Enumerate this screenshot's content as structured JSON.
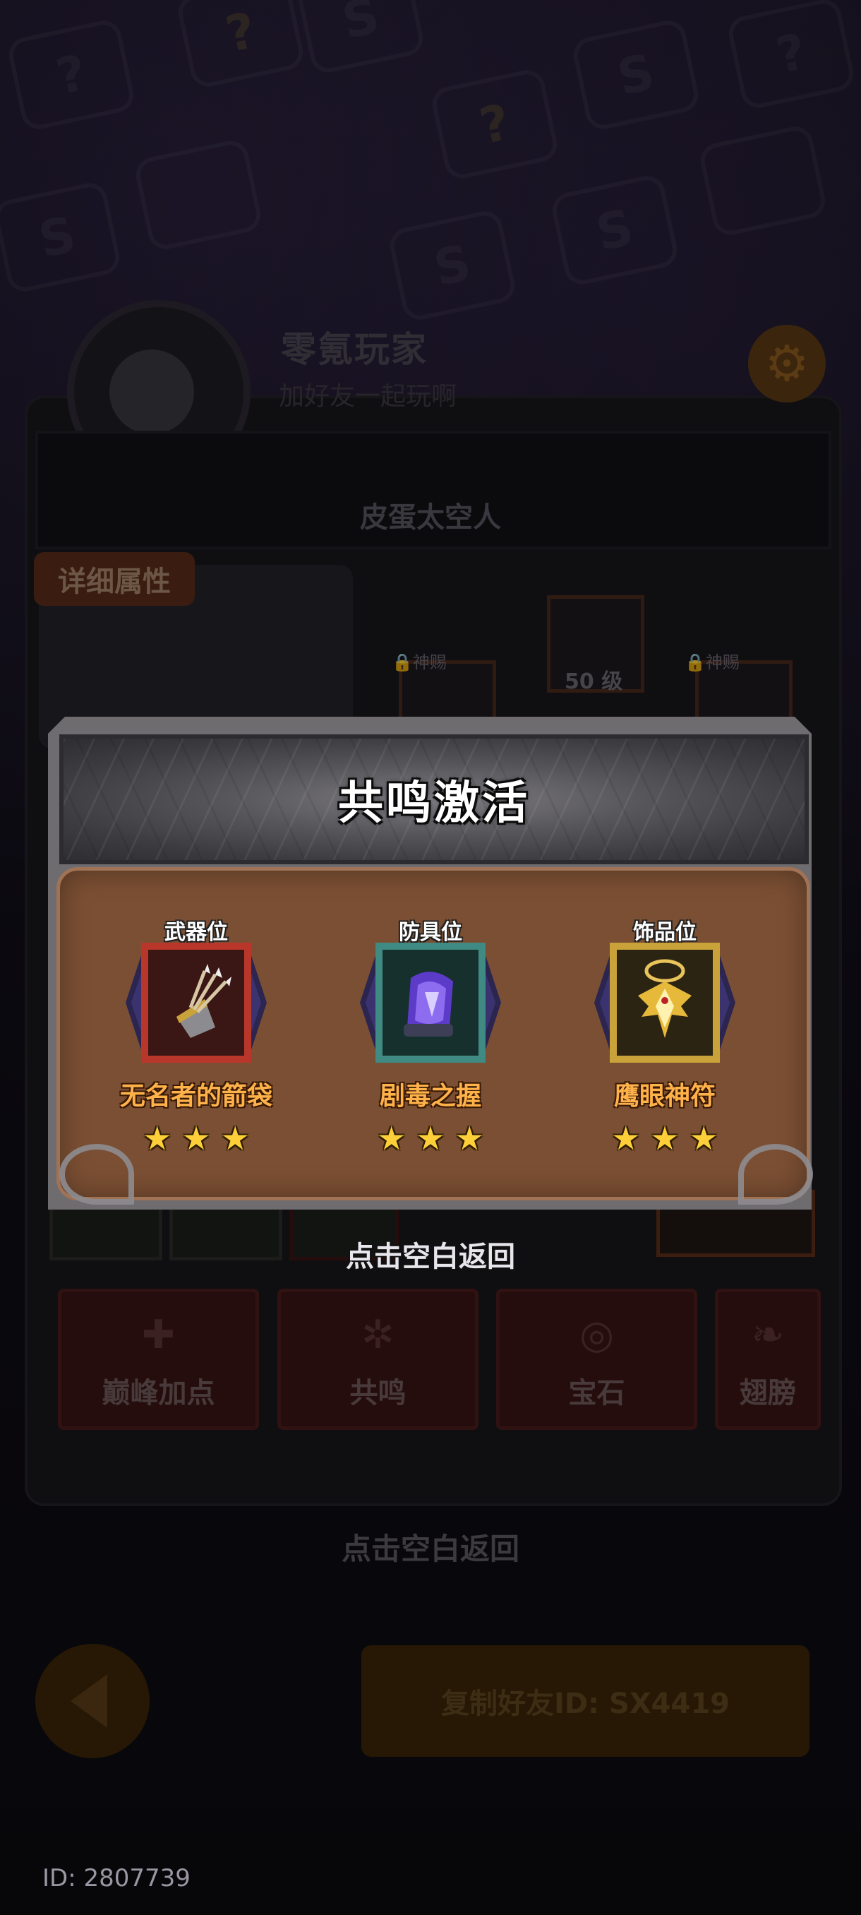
{
  "profile": {
    "player_name": "零氪玩家",
    "subtitle": "加好友一起玩啊",
    "character_name": "皮蛋太空人",
    "detail_tab": "详细属性",
    "lock_label_1": "神赐",
    "lock_label_2": "神赐",
    "level_label": "50 级",
    "return_hint": "点击空白返回"
  },
  "tabs": [
    {
      "label": "巅峰加点",
      "icon": "plus-icon"
    },
    {
      "label": "共鸣",
      "icon": "resonance-icon"
    },
    {
      "label": "宝石",
      "icon": "gem-icon"
    },
    {
      "label": "翅膀",
      "icon": "wing-icon"
    }
  ],
  "footer": {
    "copy_button": "复制好友ID: SX4419",
    "uid": "ID: 2807739"
  },
  "modal": {
    "title": "共鸣激活",
    "return_hint": "点击空白返回",
    "slots": [
      {
        "label": "武器位",
        "item": "无名者的箭袋",
        "stars": "★",
        "icon": "quiver-icon",
        "frame_color": "#b8372a",
        "inner_color": "#3a1614"
      },
      {
        "label": "防具位",
        "item": "剧毒之握",
        "stars": "★",
        "icon": "gauntlet-icon",
        "frame_color": "#3f8a82",
        "inner_color": "#16302e"
      },
      {
        "label": "饰品位",
        "item": "鹰眼神符",
        "stars": "★",
        "icon": "eagle-amulet-icon",
        "frame_color": "#c9a23a",
        "inner_color": "#2c2412"
      }
    ],
    "star_count": 3
  }
}
